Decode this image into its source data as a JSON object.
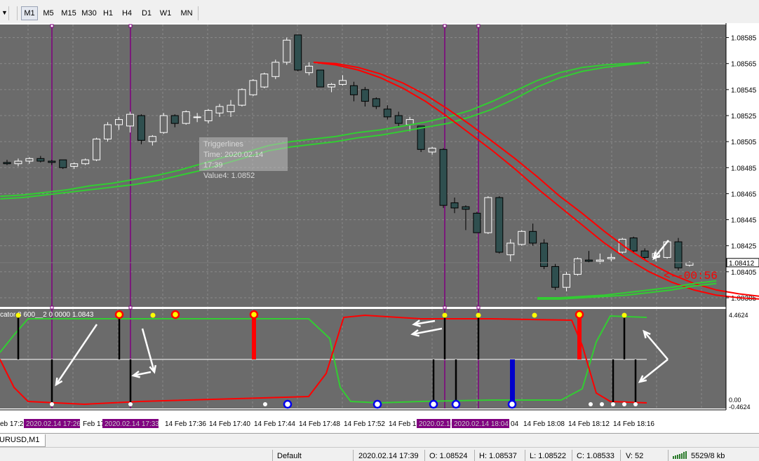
{
  "toolbar": {
    "timeframes": [
      {
        "label": "M1",
        "active": true
      },
      {
        "label": "M5",
        "active": false
      },
      {
        "label": "M15",
        "active": false
      },
      {
        "label": "M30",
        "active": false
      },
      {
        "label": "H1",
        "active": false
      },
      {
        "label": "H4",
        "active": false
      },
      {
        "label": "D1",
        "active": false
      },
      {
        "label": "W1",
        "active": false
      },
      {
        "label": "MN",
        "active": false
      }
    ]
  },
  "price_axis": {
    "labels": [
      "1.08585",
      "1.08565",
      "1.08545",
      "1.08525",
      "1.08505",
      "1.08485",
      "1.08465",
      "1.08445",
      "1.08425",
      "1.08405",
      "1.08385"
    ],
    "current_price": "1.08412",
    "countdown": "<--00:56"
  },
  "tooltip": {
    "line1": "Triggerlines",
    "line2": "Time: 2020.02.14 17:39",
    "line3": "Value4: 1.0852"
  },
  "indicator": {
    "title": "cator 8 600__2 0 0000 1.0843",
    "scale_top": "4.4624",
    "scale_zero": "0.00",
    "scale_bottom": "-0.4624"
  },
  "time_axis": {
    "labels": [
      "eb 17:20",
      "14 Feb 17:36",
      "14 Feb 17:40",
      "14 Feb 17:44",
      "14 Feb 17:48",
      "14 Feb 17:52",
      "04",
      "14 Feb 18:08",
      "14 Feb 18:12",
      "14 Feb 18:16"
    ],
    "label_feb17": "Feb 17",
    "label_feb17b": "14 Feb 17",
    "highlight_labels": [
      "2020.02.14 17:26",
      "2020.02.14 17:33",
      "2020.02.14",
      "2020.02.14 18:04"
    ]
  },
  "tab": {
    "label": "URUSD,M1"
  },
  "status": {
    "profile": "Default",
    "datetime": "2020.02.14 17:39",
    "open": "O: 1.08524",
    "high": "H: 1.08537",
    "low": "L: 1.08522",
    "close": "C: 1.08533",
    "volume": "V: 52",
    "traffic": "5529/8 kb"
  },
  "colors": {
    "chart_bg": "#6b6b6b",
    "bull_candle": "#ffffff",
    "bear_candle": "#2f4f4f",
    "green_line": "#32cd32",
    "red_line": "#ff0000",
    "vertical_marker": "#800080",
    "highlight_label_bg": "#800080"
  },
  "chart_data": {
    "type": "candlestick",
    "symbol": "EURUSD",
    "timeframe": "M1",
    "candles": [
      {
        "o": 1.08489,
        "h": 1.08491,
        "l": 1.08487,
        "c": 1.08488
      },
      {
        "o": 1.08488,
        "h": 1.08492,
        "l": 1.08486,
        "c": 1.0849
      },
      {
        "o": 1.0849,
        "h": 1.08493,
        "l": 1.08488,
        "c": 1.08492
      },
      {
        "o": 1.08492,
        "h": 1.08494,
        "l": 1.08489,
        "c": 1.0849
      },
      {
        "o": 1.0849,
        "h": 1.08491,
        "l": 1.08487,
        "c": 1.08489
      },
      {
        "o": 1.08491,
        "h": 1.08491,
        "l": 1.08484,
        "c": 1.08485
      },
      {
        "o": 1.08486,
        "h": 1.08489,
        "l": 1.08484,
        "c": 1.08488
      },
      {
        "o": 1.08488,
        "h": 1.08492,
        "l": 1.08487,
        "c": 1.08491
      },
      {
        "o": 1.08491,
        "h": 1.08508,
        "l": 1.0849,
        "c": 1.08507
      },
      {
        "o": 1.08507,
        "h": 1.0852,
        "l": 1.08505,
        "c": 1.08518
      },
      {
        "o": 1.08518,
        "h": 1.08524,
        "l": 1.08514,
        "c": 1.08522
      },
      {
        "o": 1.08517,
        "h": 1.08528,
        "l": 1.08512,
        "c": 1.08526
      },
      {
        "o": 1.08525,
        "h": 1.08526,
        "l": 1.08503,
        "c": 1.08506
      },
      {
        "o": 1.08505,
        "h": 1.0851,
        "l": 1.08502,
        "c": 1.08509
      },
      {
        "o": 1.08512,
        "h": 1.08527,
        "l": 1.08511,
        "c": 1.08525
      },
      {
        "o": 1.08525,
        "h": 1.08526,
        "l": 1.08516,
        "c": 1.08519
      },
      {
        "o": 1.08519,
        "h": 1.08529,
        "l": 1.08518,
        "c": 1.08528
      },
      {
        "o": 1.08524,
        "h": 1.08527,
        "l": 1.0852,
        "c": 1.08524
      },
      {
        "o": 1.08521,
        "h": 1.0853,
        "l": 1.08519,
        "c": 1.08529
      },
      {
        "o": 1.08527,
        "h": 1.08534,
        "l": 1.08524,
        "c": 1.08532
      },
      {
        "o": 1.08528,
        "h": 1.08537,
        "l": 1.08524,
        "c": 1.08533
      },
      {
        "o": 1.08533,
        "h": 1.08546,
        "l": 1.08532,
        "c": 1.08545
      },
      {
        "o": 1.08541,
        "h": 1.08553,
        "l": 1.0854,
        "c": 1.08552
      },
      {
        "o": 1.08547,
        "h": 1.08558,
        "l": 1.08546,
        "c": 1.08557
      },
      {
        "o": 1.08555,
        "h": 1.08568,
        "l": 1.08553,
        "c": 1.08566
      },
      {
        "o": 1.08566,
        "h": 1.08585,
        "l": 1.08564,
        "c": 1.08583
      },
      {
        "o": 1.08587,
        "h": 1.08587,
        "l": 1.08559,
        "c": 1.0856
      },
      {
        "o": 1.08558,
        "h": 1.08566,
        "l": 1.08556,
        "c": 1.08563
      },
      {
        "o": 1.0856,
        "h": 1.0856,
        "l": 1.08547,
        "c": 1.08547
      },
      {
        "o": 1.08547,
        "h": 1.0855,
        "l": 1.08543,
        "c": 1.08549
      },
      {
        "o": 1.08549,
        "h": 1.08556,
        "l": 1.08548,
        "c": 1.08552
      },
      {
        "o": 1.08548,
        "h": 1.08551,
        "l": 1.08536,
        "c": 1.08541
      },
      {
        "o": 1.08545,
        "h": 1.08547,
        "l": 1.08532,
        "c": 1.08536
      },
      {
        "o": 1.08538,
        "h": 1.08539,
        "l": 1.0853,
        "c": 1.08532
      },
      {
        "o": 1.0853,
        "h": 1.08533,
        "l": 1.08522,
        "c": 1.08524
      },
      {
        "o": 1.08525,
        "h": 1.08528,
        "l": 1.08516,
        "c": 1.08519
      },
      {
        "o": 1.08518,
        "h": 1.08524,
        "l": 1.08513,
        "c": 1.08522
      },
      {
        "o": 1.08517,
        "h": 1.08517,
        "l": 1.08497,
        "c": 1.08499
      },
      {
        "o": 1.08497,
        "h": 1.08501,
        "l": 1.08495,
        "c": 1.085
      },
      {
        "o": 1.08499,
        "h": 1.085,
        "l": 1.08454,
        "c": 1.08456
      },
      {
        "o": 1.08458,
        "h": 1.08462,
        "l": 1.0845,
        "c": 1.08454
      },
      {
        "o": 1.08455,
        "h": 1.08456,
        "l": 1.08437,
        "c": 1.08453
      },
      {
        "o": 1.0845,
        "h": 1.08451,
        "l": 1.08435,
        "c": 1.08435
      },
      {
        "o": 1.08435,
        "h": 1.08463,
        "l": 1.08434,
        "c": 1.08462
      },
      {
        "o": 1.08462,
        "h": 1.08463,
        "l": 1.08419,
        "c": 1.0842
      },
      {
        "o": 1.08418,
        "h": 1.0843,
        "l": 1.08413,
        "c": 1.08427
      },
      {
        "o": 1.08426,
        "h": 1.08437,
        "l": 1.08425,
        "c": 1.08436
      },
      {
        "o": 1.08436,
        "h": 1.08442,
        "l": 1.08425,
        "c": 1.08427
      },
      {
        "o": 1.08427,
        "h": 1.0843,
        "l": 1.08407,
        "c": 1.08409
      },
      {
        "o": 1.08409,
        "h": 1.08411,
        "l": 1.08391,
        "c": 1.08393
      },
      {
        "o": 1.08393,
        "h": 1.08405,
        "l": 1.0839,
        "c": 1.08403
      },
      {
        "o": 1.08403,
        "h": 1.08416,
        "l": 1.08402,
        "c": 1.08415
      },
      {
        "o": 1.08414,
        "h": 1.08421,
        "l": 1.08412,
        "c": 1.08413
      },
      {
        "o": 1.08413,
        "h": 1.08419,
        "l": 1.08411,
        "c": 1.08414
      },
      {
        "o": 1.08415,
        "h": 1.08419,
        "l": 1.08413,
        "c": 1.08416
      },
      {
        "o": 1.0842,
        "h": 1.08431,
        "l": 1.08419,
        "c": 1.0843
      },
      {
        "o": 1.08431,
        "h": 1.08432,
        "l": 1.0842,
        "c": 1.08421
      },
      {
        "o": 1.08421,
        "h": 1.08423,
        "l": 1.08414,
        "c": 1.08416
      },
      {
        "o": 1.08416,
        "h": 1.08422,
        "l": 1.08413,
        "c": 1.08419
      },
      {
        "o": 1.08416,
        "h": 1.08429,
        "l": 1.08415,
        "c": 1.08428
      },
      {
        "o": 1.08428,
        "h": 1.08431,
        "l": 1.08406,
        "c": 1.08408
      },
      {
        "o": 1.0841,
        "h": 1.08413,
        "l": 1.08409,
        "c": 1.08412
      }
    ],
    "green_band_upper": [
      1.08463,
      1.08464,
      1.08466,
      1.08468,
      1.08471,
      1.08473,
      1.08476,
      1.08479,
      1.08483,
      1.08488,
      1.08493,
      1.08497,
      1.08502,
      1.08505,
      1.08507,
      1.08509,
      1.08512,
      1.08514,
      1.08517,
      1.0852,
      1.08524,
      1.08529,
      1.08536,
      1.08544,
      1.08552,
      1.08558,
      1.08562,
      1.08564,
      1.08565,
      1.08566
    ],
    "green_band_lower": [
      1.08461,
      1.08462,
      1.08464,
      1.08466,
      1.08468,
      1.0847,
      1.08472,
      1.08475,
      1.08479,
      1.08483,
      1.08488,
      1.08493,
      1.08498,
      1.08501,
      1.08503,
      1.08505,
      1.08508,
      1.0851,
      1.08513,
      1.08516,
      1.08519,
      1.08524,
      1.0853,
      1.08538,
      1.08547,
      1.08554,
      1.08559,
      1.08562,
      1.08564,
      1.08566
    ],
    "red_band_upper": [
      1.08566,
      1.08565,
      1.08562,
      1.08557,
      1.0855,
      1.08541,
      1.0853,
      1.08518,
      1.08505,
      1.08492,
      1.08478,
      1.08463,
      1.0845,
      1.08436,
      1.08423,
      1.08412,
      1.08403,
      1.08396,
      1.08391,
      1.08388,
      1.08386
    ],
    "red_band_lower": [
      1.08566,
      1.08564,
      1.0856,
      1.08554,
      1.08546,
      1.08536,
      1.08524,
      1.08511,
      1.08498,
      1.08484,
      1.08469,
      1.08455,
      1.08441,
      1.08427,
      1.08415,
      1.08405,
      1.08397,
      1.08391,
      1.08387,
      1.08385,
      1.08384
    ],
    "green_tail": [
      1.08385,
      1.08385,
      1.08386,
      1.08387,
      1.08389,
      1.08391,
      1.08393,
      1.08396,
      1.08398
    ],
    "green_tail2": [
      1.08384,
      1.08384,
      1.08385,
      1.08386,
      1.08387,
      1.08389,
      1.08391,
      1.08394,
      1.08396
    ]
  }
}
